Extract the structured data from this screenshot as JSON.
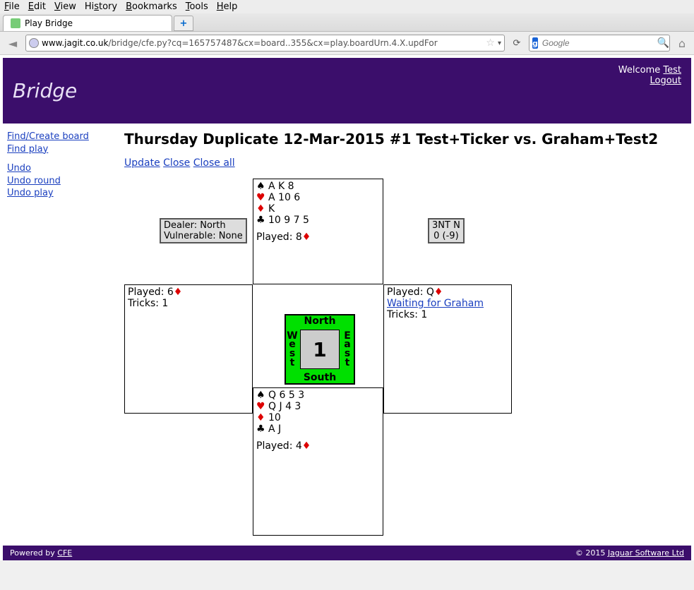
{
  "browser": {
    "menu": [
      "File",
      "Edit",
      "View",
      "History",
      "Bookmarks",
      "Tools",
      "Help"
    ],
    "tab_title": "Play Bridge",
    "url_host": "www.jagit.co.uk",
    "url_path": "/bridge/cfe.py?cq=165757487&cx=board..355&cx=play.boardUrn.4.X.updFor",
    "search_placeholder": "Google"
  },
  "banner": {
    "title": "Bridge",
    "welcome": "Welcome",
    "user": "Test",
    "logout": "Logout"
  },
  "sidebar": {
    "find_create": "Find/Create board",
    "find_play": "Find play",
    "undo": "Undo",
    "undo_round": "Undo round",
    "undo_play": "Undo play"
  },
  "page": {
    "heading": "Thursday Duplicate 12-Mar-2015 #1 Test+Ticker vs. Graham+Test2",
    "actions": {
      "update": "Update",
      "close": "Close",
      "close_all": "Close all"
    }
  },
  "board": {
    "dealer_line1": "Dealer: North",
    "dealer_line2": "Vulnerable: None",
    "contract_line1": "3NT N",
    "contract_line2": "0 (-9)",
    "board_number": "1",
    "compass": {
      "n": "North",
      "s": "South",
      "w_letters": [
        "W",
        "e",
        "s",
        "t"
      ],
      "e_letters": [
        "E",
        "a",
        "s",
        "t"
      ]
    },
    "north": {
      "spades": "A K 8",
      "hearts": "A 10 6",
      "diamonds": "K",
      "clubs": "10 9 7 5",
      "played_label": "Played: ",
      "played_card": "8",
      "played_suit": "d"
    },
    "south": {
      "spades": "Q 6 5 3",
      "hearts": "Q J 4 3",
      "diamonds": "10",
      "clubs": "A J",
      "played_label": "Played: ",
      "played_card": "4",
      "played_suit": "d"
    },
    "west": {
      "played_label": "Played: ",
      "played_card": "6",
      "played_suit": "d",
      "tricks": "Tricks: 1"
    },
    "east": {
      "played_label": "Played: ",
      "played_card": "Q",
      "played_suit": "d",
      "waiting": "Waiting for Graham",
      "tricks": "Tricks: 1"
    }
  },
  "footer": {
    "left_prefix": "Powered by ",
    "left_link": "CFE",
    "right_prefix": "© 2015 ",
    "right_link": "Jaguar Software Ltd"
  }
}
